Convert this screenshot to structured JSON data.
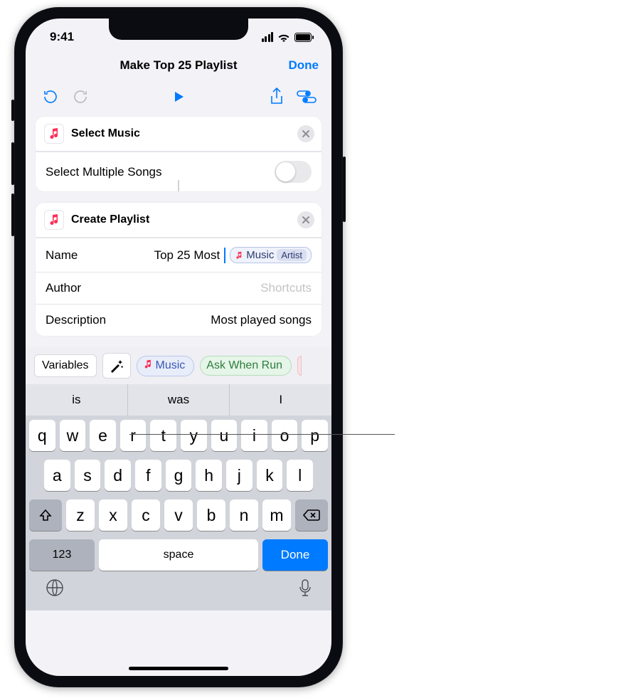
{
  "status": {
    "time": "9:41"
  },
  "nav": {
    "title": "Make Top 25 Playlist",
    "done": "Done"
  },
  "actions": {
    "select_music": {
      "title": "Select Music",
      "multiple_label": "Select Multiple Songs"
    },
    "create_playlist": {
      "title": "Create Playlist",
      "name_label": "Name",
      "name_text": "Top 25 Most",
      "name_token_main": "Music",
      "name_token_sub": "Artist",
      "author_label": "Author",
      "author_placeholder": "Shortcuts",
      "desc_label": "Description",
      "desc_value": "Most played songs"
    }
  },
  "varbar": {
    "variables": "Variables",
    "music": "Music",
    "ask": "Ask When Run"
  },
  "keyboard": {
    "suggestions": [
      "is",
      "was",
      "I"
    ],
    "row1": [
      "q",
      "w",
      "e",
      "r",
      "t",
      "y",
      "u",
      "i",
      "o",
      "p"
    ],
    "row2": [
      "a",
      "s",
      "d",
      "f",
      "g",
      "h",
      "j",
      "k",
      "l"
    ],
    "row3": [
      "z",
      "x",
      "c",
      "v",
      "b",
      "n",
      "m"
    ],
    "numkey": "123",
    "space": "space",
    "done": "Done"
  }
}
